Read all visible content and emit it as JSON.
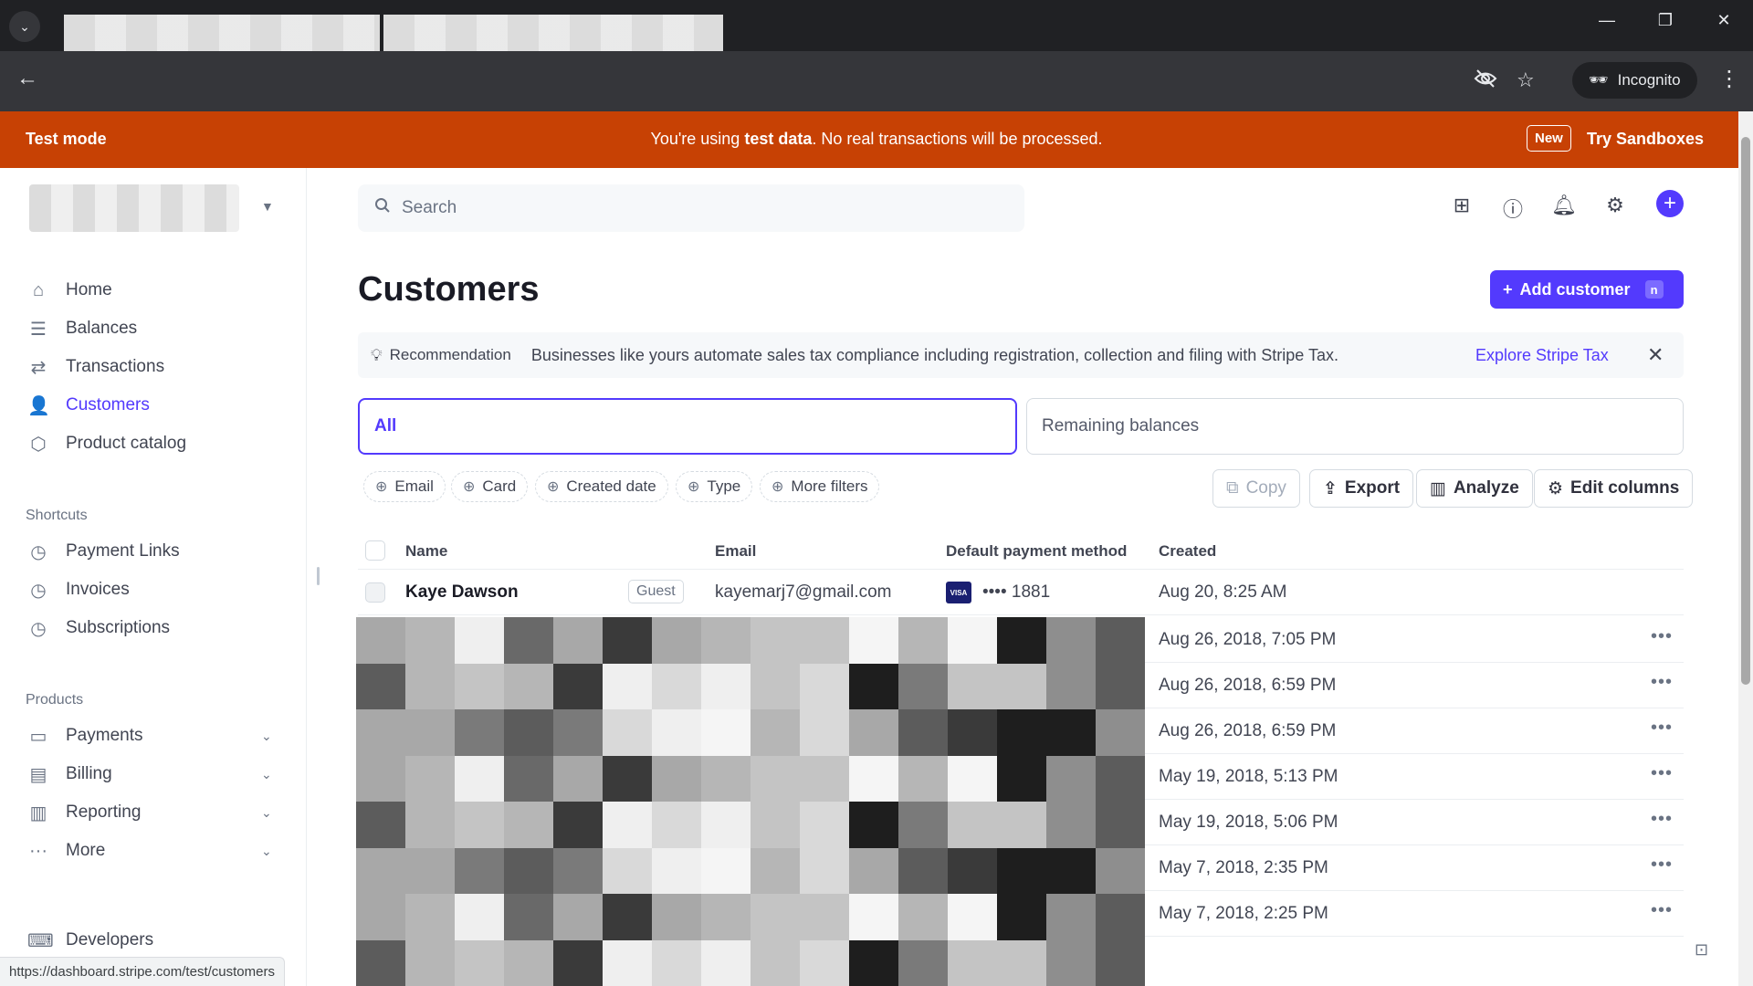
{
  "browser": {
    "incognito_label": "Incognito",
    "status_url": "https://dashboard.stripe.com/test/customers"
  },
  "banner": {
    "test_mode": "Test mode",
    "msg_prefix": "You're using ",
    "msg_bold": "test data",
    "msg_suffix": ". No real transactions will be processed.",
    "new_badge": "New",
    "try_sandboxes": "Try Sandboxes"
  },
  "sidebar": {
    "main_items": [
      {
        "label": "Home",
        "icon": "home-icon"
      },
      {
        "label": "Balances",
        "icon": "balances-icon"
      },
      {
        "label": "Transactions",
        "icon": "transactions-icon"
      },
      {
        "label": "Customers",
        "icon": "customers-icon",
        "active": true
      },
      {
        "label": "Product catalog",
        "icon": "product-catalog-icon"
      }
    ],
    "shortcuts_title": "Shortcuts",
    "shortcuts": [
      {
        "label": "Payment Links",
        "icon": "clock-icon"
      },
      {
        "label": "Invoices",
        "icon": "clock-icon"
      },
      {
        "label": "Subscriptions",
        "icon": "clock-icon"
      }
    ],
    "products_title": "Products",
    "products": [
      {
        "label": "Payments",
        "icon": "payments-icon"
      },
      {
        "label": "Billing",
        "icon": "billing-icon"
      },
      {
        "label": "Reporting",
        "icon": "reporting-icon"
      },
      {
        "label": "More",
        "icon": "more-icon"
      }
    ],
    "developers": "Developers"
  },
  "search": {
    "placeholder": "Search"
  },
  "page": {
    "title": "Customers",
    "add_customer": "Add customer",
    "add_customer_shortcut": "n"
  },
  "recommendation": {
    "label": "Recommendation",
    "text": "Businesses like yours automate sales tax compliance including registration, collection and filing with Stripe Tax.",
    "link": "Explore Stripe Tax"
  },
  "filter_tabs": {
    "all": "All",
    "remaining": "Remaining balances"
  },
  "filters": [
    "Email",
    "Card",
    "Created date",
    "Type",
    "More filters"
  ],
  "tools": {
    "copy": "Copy",
    "export": "Export",
    "analyze": "Analyze",
    "edit_columns": "Edit columns"
  },
  "table": {
    "columns": {
      "name": "Name",
      "email": "Email",
      "payment": "Default payment method",
      "created": "Created"
    },
    "first_row": {
      "name": "Kaye Dawson",
      "badge": "Guest",
      "email": "kayemarj7@gmail.com",
      "card_brand": "VISA",
      "card_last4": "•••• 1881",
      "created": "Aug 20, 8:25 AM"
    },
    "rows_created": [
      "Aug 26, 2018, 7:05 PM",
      "Aug 26, 2018, 6:59 PM",
      "Aug 26, 2018, 6:59 PM",
      "May 19, 2018, 5:13 PM",
      "May 19, 2018, 5:06 PM",
      "May 7, 2018, 2:35 PM",
      "May 7, 2018, 2:25 PM"
    ],
    "row_menu": "•••"
  },
  "colors": {
    "accent": "#533afd",
    "banner": "#c74104"
  }
}
